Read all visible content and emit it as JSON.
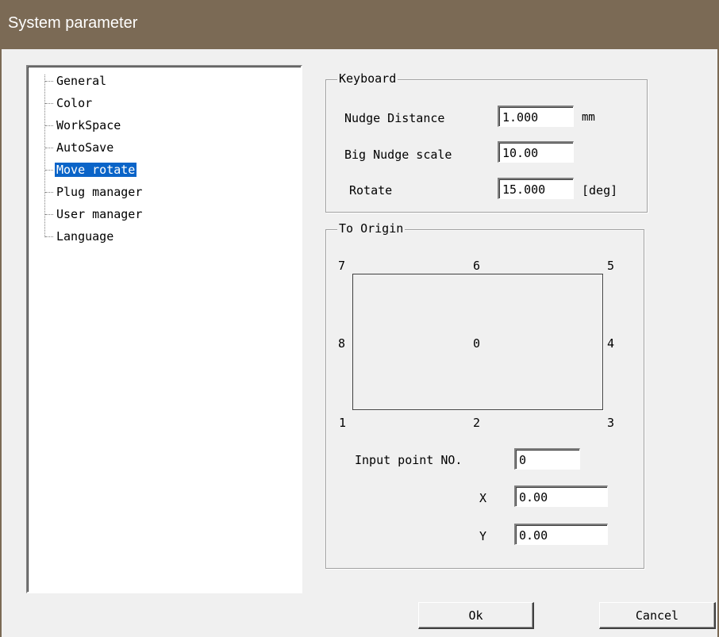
{
  "window": {
    "title": "System parameter"
  },
  "tree": {
    "items": [
      {
        "label": "General",
        "selected": false
      },
      {
        "label": "Color",
        "selected": false
      },
      {
        "label": "WorkSpace",
        "selected": false
      },
      {
        "label": "AutoSave",
        "selected": false
      },
      {
        "label": "Move rotate",
        "selected": true
      },
      {
        "label": "Plug manager",
        "selected": false
      },
      {
        "label": "User manager",
        "selected": false
      },
      {
        "label": "Language",
        "selected": false
      }
    ]
  },
  "keyboard": {
    "group_label": "Keyboard",
    "nudge_distance_label": "Nudge Distance",
    "nudge_distance_value": "1.000",
    "nudge_distance_unit": "mm",
    "big_nudge_label": "Big Nudge scale",
    "big_nudge_value": "10.00",
    "rotate_label": "Rotate",
    "rotate_value": "15.000",
    "rotate_unit": "[deg]"
  },
  "origin": {
    "group_label": "To Origin",
    "points": {
      "p0": "0",
      "p1": "1",
      "p2": "2",
      "p3": "3",
      "p4": "4",
      "p5": "5",
      "p6": "6",
      "p7": "7",
      "p8": "8"
    },
    "input_point_label": "Input point NO.",
    "input_point_value": "0",
    "x_label": "X",
    "x_value": "0.00",
    "y_label": "Y",
    "y_value": "0.00"
  },
  "buttons": {
    "ok": "Ok",
    "cancel": "Cancel"
  }
}
